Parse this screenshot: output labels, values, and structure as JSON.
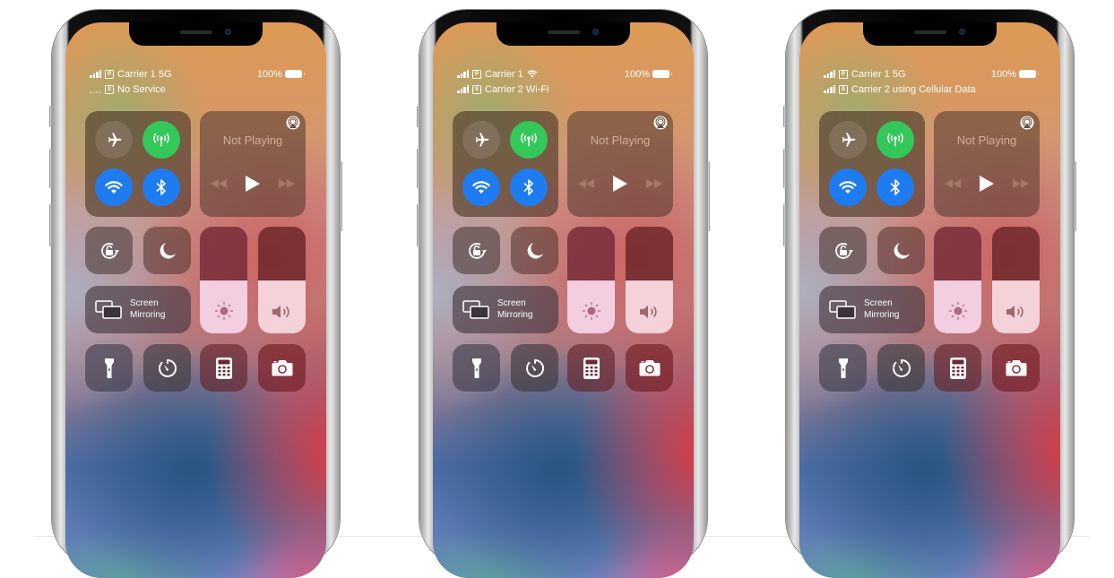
{
  "phones": [
    {
      "id": "no-service",
      "status": {
        "line1": {
          "sim": "P",
          "carrier": "Carrier 1 5G",
          "signal_bars": 4,
          "wifi": false
        },
        "line2": {
          "sim": "S",
          "carrier": "No Service",
          "signal_bars": 0,
          "wifi": false
        },
        "battery_label": "100%",
        "battery_level": 1.0
      }
    },
    {
      "id": "wifi",
      "status": {
        "line1": {
          "sim": "P",
          "carrier": "Carrier 1",
          "signal_bars": 4,
          "wifi": true
        },
        "line2": {
          "sim": "S",
          "carrier": "Carrier 2 Wi-Fi",
          "signal_bars": 4,
          "wifi": false
        },
        "battery_label": "100%",
        "battery_level": 1.0
      }
    },
    {
      "id": "cellular-data",
      "status": {
        "line1": {
          "sim": "P",
          "carrier": "Carrier 1 5G",
          "signal_bars": 4,
          "wifi": false
        },
        "line2": {
          "sim": "S",
          "carrier": "Carrier 2 using Cellular Data",
          "signal_bars": 4,
          "wifi": false
        },
        "battery_label": "100%",
        "battery_level": 1.0
      }
    }
  ],
  "control_center": {
    "connectivity": {
      "airplane_mode": {
        "icon": "airplane-icon",
        "on": false
      },
      "cellular_data": {
        "icon": "antenna-icon",
        "on": true,
        "color": "#34c759"
      },
      "wifi": {
        "icon": "wifi-icon",
        "on": true,
        "color": "#1f7cf0"
      },
      "bluetooth": {
        "icon": "bluetooth-icon",
        "on": true,
        "color": "#1f7cf0"
      }
    },
    "media": {
      "title": "Not Playing",
      "airplay_icon": "airplay-icon",
      "controls": [
        "rewind-icon",
        "play-icon",
        "fast-forward-icon"
      ]
    },
    "orientation_lock": {
      "icon": "rotation-lock-icon"
    },
    "do_not_disturb": {
      "icon": "moon-icon"
    },
    "screen_mirroring": {
      "line1": "Screen",
      "line2": "Mirroring",
      "icon": "screen-mirroring-icon"
    },
    "brightness": {
      "icon": "sun-icon",
      "level": 0.5,
      "fill_color": "#f3cde0"
    },
    "volume": {
      "icon": "speaker-icon",
      "level": 0.5,
      "fill_color": "#f4d2d8"
    },
    "shortcuts": [
      "flashlight-icon",
      "timer-icon",
      "calculator-icon",
      "camera-icon"
    ]
  }
}
